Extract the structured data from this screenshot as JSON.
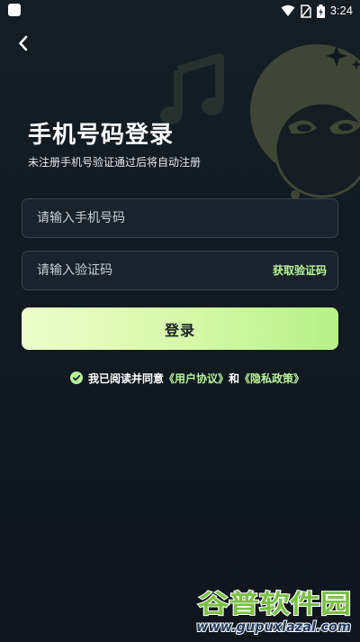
{
  "status_bar": {
    "time": "3:24"
  },
  "header": {
    "title": "手机号码登录",
    "subtitle": "未注册手机号验证通过后将自动注册"
  },
  "phone_input": {
    "placeholder": "请输入手机号码",
    "value": ""
  },
  "code_input": {
    "placeholder": "请输入验证码",
    "value": "",
    "get_code_label": "获取验证码"
  },
  "login": {
    "label": "登录"
  },
  "agreement": {
    "text_prefix": "我已阅读并同意",
    "user_agreement": "《用户协议》",
    "connector": "和",
    "privacy_policy": "《隐私政策》",
    "checked": true
  },
  "watermark": {
    "brand": "谷普软件园",
    "url": "www.gupuxlazal.com"
  },
  "colors": {
    "background": "#121a22",
    "accent_green": "#b6f39a",
    "login_gradient_start": "#edfccc",
    "login_gradient_end": "#b6f08a",
    "input_border": "#3b444c"
  },
  "icons": [
    "app-icon",
    "wifi-icon",
    "no-sim-icon",
    "battery-icon",
    "back-arrow-icon",
    "music-note-icon",
    "mascot-icon",
    "check-circle-icon"
  ]
}
